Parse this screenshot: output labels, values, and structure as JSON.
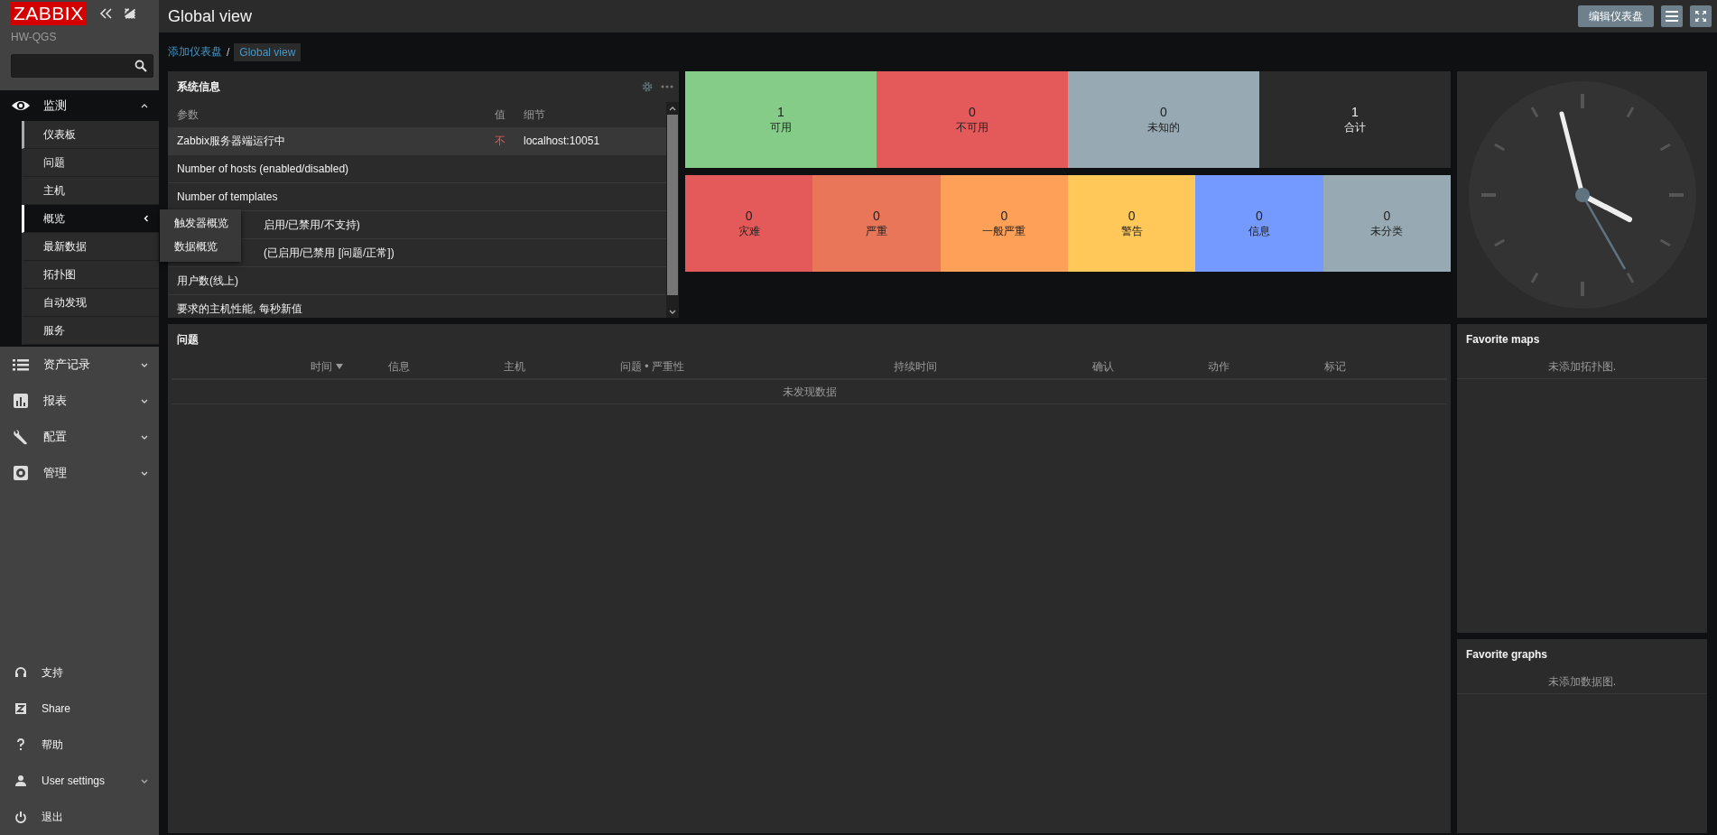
{
  "sidebar": {
    "logo": "ZABBIX",
    "server_name": "HW-QGS",
    "menu": [
      {
        "label": "监测",
        "expanded": true,
        "children": [
          {
            "label": "仪表板",
            "selected": true,
            "open": false
          },
          {
            "label": "问题",
            "selected": false,
            "open": false
          },
          {
            "label": "主机",
            "selected": false,
            "open": false
          },
          {
            "label": "概览",
            "selected": false,
            "open": true
          },
          {
            "label": "最新数据",
            "selected": false,
            "open": false
          },
          {
            "label": "拓扑图",
            "selected": false,
            "open": false
          },
          {
            "label": "自动发现",
            "selected": false,
            "open": false
          },
          {
            "label": "服务",
            "selected": false,
            "open": false
          }
        ]
      },
      {
        "label": "资产记录",
        "expanded": false
      },
      {
        "label": "报表",
        "expanded": false
      },
      {
        "label": "配置",
        "expanded": false
      },
      {
        "label": "管理",
        "expanded": false
      }
    ],
    "footer": [
      {
        "label": "支持",
        "has_submenu": false
      },
      {
        "label": "Share",
        "has_submenu": false
      },
      {
        "label": "帮助",
        "has_submenu": false
      },
      {
        "label": "User settings",
        "has_submenu": true
      },
      {
        "label": "退出",
        "has_submenu": false
      }
    ]
  },
  "popup_menu": [
    "触发器概览",
    "数据概览"
  ],
  "header": {
    "title": "Global view",
    "edit_button": "编辑仪表盘"
  },
  "breadcrumb_separator": "/",
  "breadcrumbs": [
    {
      "label": "添加仪表盘",
      "current": false
    },
    {
      "label": "Global view",
      "current": true
    }
  ],
  "system_info": {
    "title": "系统信息",
    "columns": [
      "参数",
      "值",
      "细节"
    ],
    "rows": [
      {
        "parameter": "Zabbix服务器端运行中",
        "value": "不",
        "details": "localhost:10051",
        "hovered": true,
        "partly_covered": false
      },
      {
        "parameter": "Number of hosts (enabled/disabled)",
        "hovered": false,
        "partly_covered": false
      },
      {
        "parameter": "Number of templates",
        "hovered": false,
        "partly_covered": false
      },
      {
        "parameter": "启用/已禁用/不支持)",
        "hovered": false,
        "partly_covered": true
      },
      {
        "parameter": "(已启用/已禁用 [问题/正常])",
        "hovered": false,
        "partly_covered": true
      },
      {
        "parameter": "用户数(线上)",
        "hovered": false,
        "partly_covered": false
      },
      {
        "parameter": "要求的主机性能, 每秒新值",
        "hovered": false,
        "partly_covered": false
      }
    ]
  },
  "host_availability": [
    {
      "count": "1",
      "label": "可用",
      "kind": "status",
      "color": "#86cc89"
    },
    {
      "count": "0",
      "label": "不可用",
      "kind": "status",
      "color": "#e45959"
    },
    {
      "count": "0",
      "label": "未知的",
      "kind": "status",
      "color": "#97aab3"
    },
    {
      "count": "1",
      "label": "合计",
      "kind": "total"
    }
  ],
  "problems_by_severity": [
    {
      "count": "0",
      "label": "灾难",
      "color": "#e45959"
    },
    {
      "count": "0",
      "label": "严重",
      "color": "#e97659"
    },
    {
      "count": "0",
      "label": "一般严重",
      "color": "#ffa059"
    },
    {
      "count": "0",
      "label": "警告",
      "color": "#ffc859"
    },
    {
      "count": "0",
      "label": "信息",
      "color": "#7499ff"
    },
    {
      "count": "0",
      "label": "未分类",
      "color": "#97aab3"
    }
  ],
  "problems": {
    "title": "问题",
    "columns": [
      {
        "label": "时间",
        "sorted": true
      },
      {
        "label": "信息",
        "sorted": false
      },
      {
        "label": "主机",
        "sorted": false
      },
      {
        "label": "问题 • 严重性",
        "sorted": false
      },
      {
        "label": "持续时间",
        "sorted": false
      },
      {
        "label": "确认",
        "sorted": false
      },
      {
        "label": "动作",
        "sorted": false
      },
      {
        "label": "标记",
        "sorted": false
      }
    ],
    "empty_message": "未发现数据"
  },
  "favorite_maps": {
    "title": "Favorite maps",
    "empty_message": "未添加拓扑图."
  },
  "favorite_graphs": {
    "title": "Favorite graphs",
    "empty_message": "未添加数据图."
  }
}
